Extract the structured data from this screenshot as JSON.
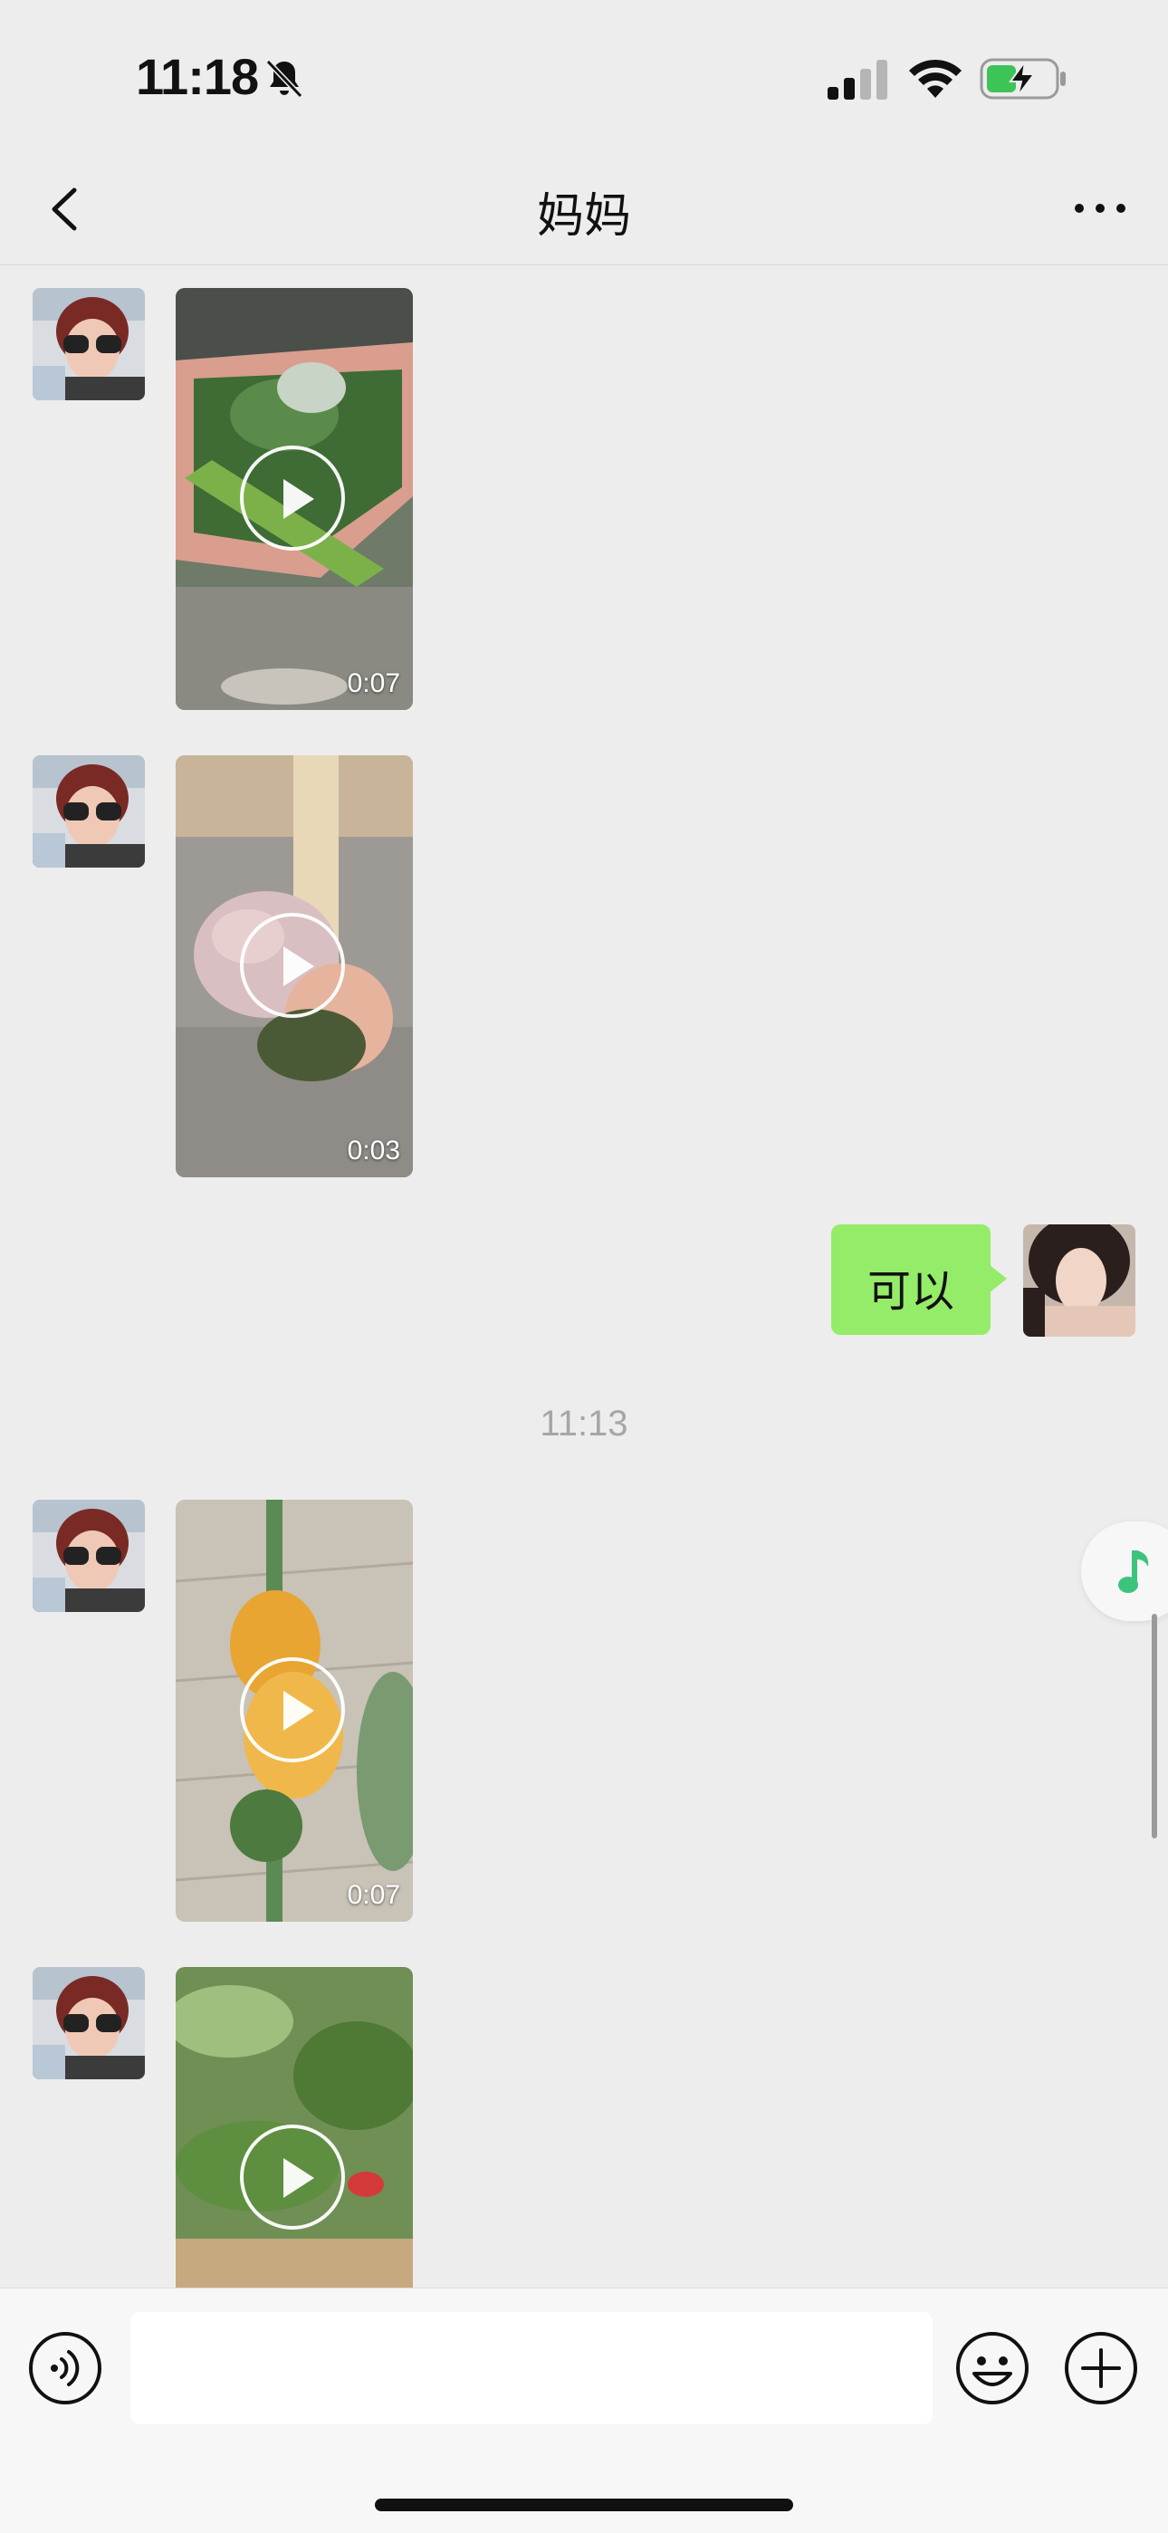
{
  "status_bar": {
    "time": "11:18",
    "icons": [
      "bell-slash-icon",
      "signal-icon",
      "wifi-icon",
      "battery-charging-icon"
    ]
  },
  "nav": {
    "title": "妈妈",
    "back_icon": "chevron-left-icon",
    "more_icon": "more-dots-icon"
  },
  "messages": [
    {
      "type": "video",
      "sender": "contact",
      "duration": "0:07"
    },
    {
      "type": "video",
      "sender": "contact",
      "duration": "0:03"
    },
    {
      "type": "text",
      "sender": "self",
      "text": "可以"
    },
    {
      "type": "timestamp",
      "text": "11:13"
    },
    {
      "type": "video",
      "sender": "contact",
      "duration": "0:07"
    },
    {
      "type": "video",
      "sender": "contact",
      "duration": ""
    }
  ],
  "floating": {
    "icon": "music-note-icon",
    "color": "#3cc47c"
  },
  "input_bar": {
    "voice_icon": "voice-icon",
    "placeholder": "",
    "emoji_icon": "emoji-icon",
    "plus_icon": "plus-icon"
  },
  "colors": {
    "background": "#ededed",
    "bubble_self": "#95ec69",
    "accent": "#07c160"
  }
}
